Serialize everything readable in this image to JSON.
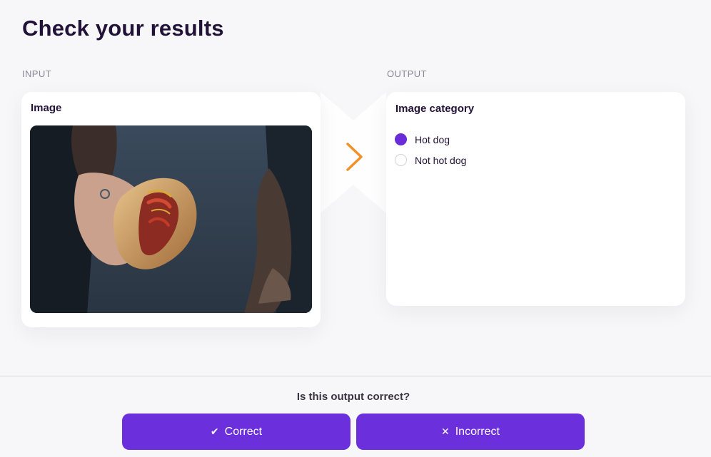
{
  "page": {
    "title": "Check your results"
  },
  "input": {
    "section_label": "INPUT",
    "card_heading": "Image",
    "image_icon": "hot-dog-photo"
  },
  "output": {
    "section_label": "OUTPUT",
    "card_heading": "Image category",
    "options": [
      {
        "label": "Hot dog",
        "selected": true
      },
      {
        "label": "Not hot dog",
        "selected": false
      }
    ]
  },
  "feedback": {
    "question": "Is this output correct?",
    "correct_label": "Correct",
    "correct_icon": "✔",
    "incorrect_label": "Incorrect",
    "incorrect_icon": "✕"
  },
  "colors": {
    "accent": "#6b2fdc",
    "arrow": "#f0922a",
    "title": "#231238"
  }
}
